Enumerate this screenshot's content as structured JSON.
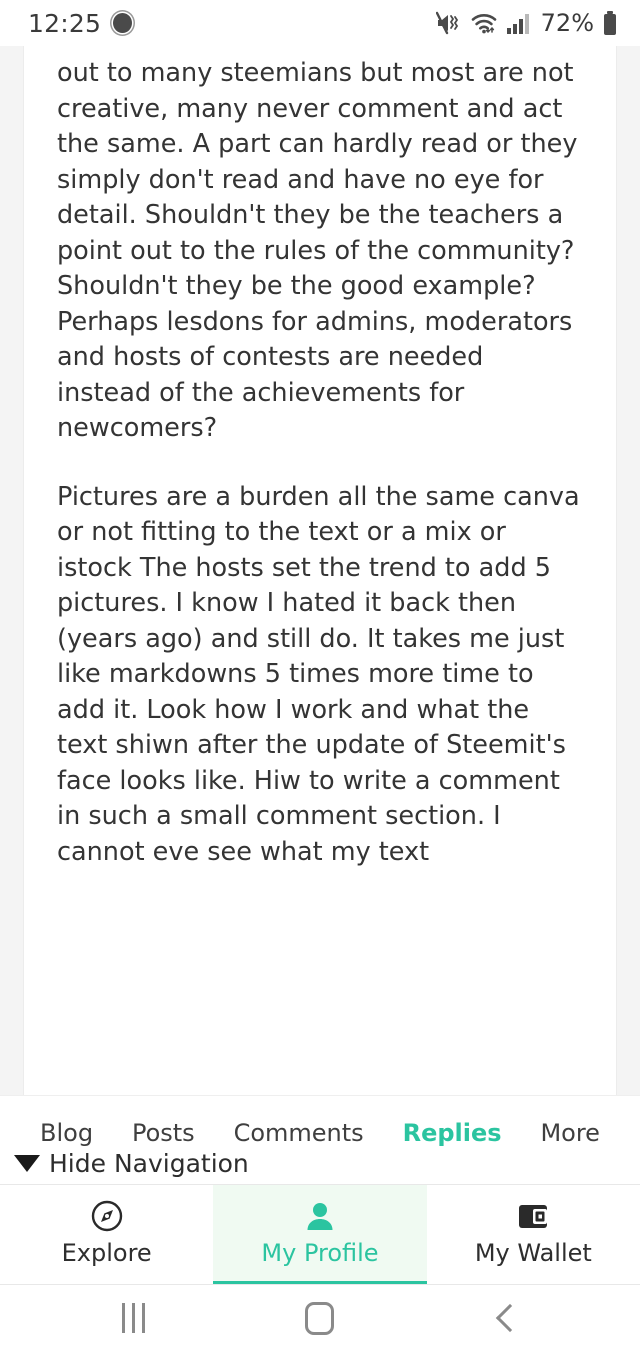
{
  "status_bar": {
    "time": "12:25",
    "battery_percent": "72%",
    "icons": {
      "notification": "notification-dot-icon",
      "mute": "mute-vibrate-icon",
      "wifi": "wifi-icon",
      "signal": "cellular-signal-icon",
      "battery": "battery-icon"
    }
  },
  "post": {
    "paragraphs": [
      "out to many steemians but most are not creative, many never comment and act the same. A part can hardly read or they simply don't read and have no eye for detail. Shouldn't they be the teachers a point out to the rules of the community? Shouldn't they be the good example? Perhaps lesdons for admins, moderators and hosts of contests are needed instead of the achievements for newcomers?",
      "Pictures are a burden all the same canva or not fitting to the text or a mix or istock The hosts set the trend to add 5 pictures. I know I hated it back then (years ago) and still do. It takes me just like markdowns 5 times more time to add it. Look how I work and what the text shiwn after the update of Steemit's face looks like. Hiw to write a comment in such a small comment section. I cannot eve see what my text"
    ]
  },
  "profile_tabs": {
    "items": [
      {
        "label": "Blog",
        "active": false
      },
      {
        "label": "Posts",
        "active": false
      },
      {
        "label": "Comments",
        "active": false
      },
      {
        "label": "Replies",
        "active": true
      },
      {
        "label": "More",
        "active": false
      }
    ]
  },
  "hide_navigation": {
    "label": "Hide Navigation",
    "caret": "caret-down-icon"
  },
  "bottom_nav": {
    "items": [
      {
        "label": "Explore",
        "icon": "compass-icon",
        "active": false
      },
      {
        "label": "My Profile",
        "icon": "person-icon",
        "active": true
      },
      {
        "label": "My Wallet",
        "icon": "wallet-icon",
        "active": false
      }
    ]
  },
  "system_nav": {
    "recents": "recents-icon",
    "home": "home-icon",
    "back": "back-icon"
  },
  "colors": {
    "accent": "#2BC4A0",
    "accent_bg": "#f0faf2",
    "text": "#343434",
    "muted": "#8a8a8a"
  }
}
